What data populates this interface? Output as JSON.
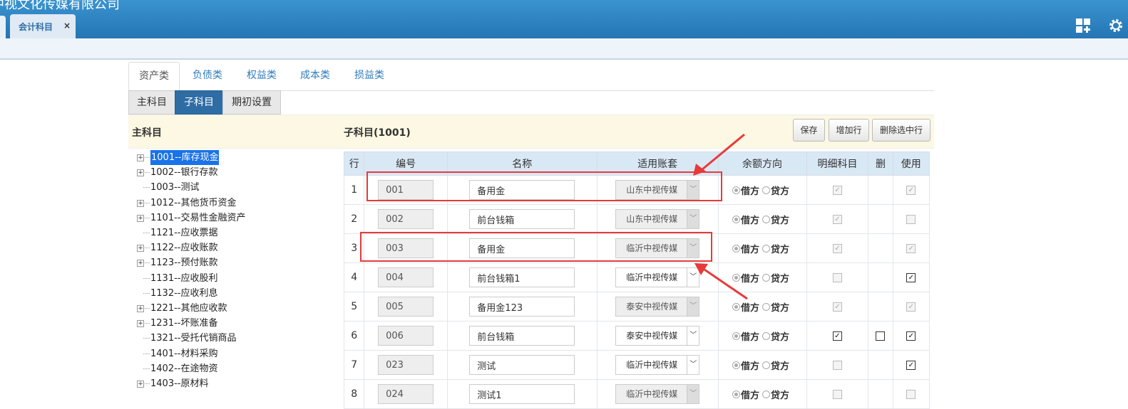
{
  "header": {
    "company": "中视文化传媒有限公司",
    "tab_label": "会计科目",
    "tab_close": "×"
  },
  "nav_tabs": [
    "资产类",
    "负债类",
    "权益类",
    "成本类",
    "损益类"
  ],
  "sub_tabs": [
    "主科目",
    "子科目",
    "期初设置"
  ],
  "panel": {
    "left_title": "主科目",
    "mid_title": "子科目(1001)",
    "buttons": [
      "保存",
      "增加行",
      "删除选中行"
    ]
  },
  "tree": [
    {
      "label": "1001--库存现金",
      "expandable": true,
      "selected": true
    },
    {
      "label": "1002--银行存款",
      "expandable": true
    },
    {
      "label": "1003--测试",
      "expandable": false
    },
    {
      "label": "1012--其他货币资金",
      "expandable": true
    },
    {
      "label": "1101--交易性金融资产",
      "expandable": true
    },
    {
      "label": "1121--应收票据",
      "expandable": false
    },
    {
      "label": "1122--应收账款",
      "expandable": true
    },
    {
      "label": "1123--预付账款",
      "expandable": true
    },
    {
      "label": "1131--应收股利",
      "expandable": false
    },
    {
      "label": "1132--应收利息",
      "expandable": false
    },
    {
      "label": "1221--其他应收款",
      "expandable": true
    },
    {
      "label": "1231--坏账准备",
      "expandable": true
    },
    {
      "label": "1321--受托代销商品",
      "expandable": false
    },
    {
      "label": "1401--材料采购",
      "expandable": false
    },
    {
      "label": "1402--在途物资",
      "expandable": false
    },
    {
      "label": "1403--原材料",
      "expandable": true
    }
  ],
  "table": {
    "headers": [
      "行",
      "编号",
      "名称",
      "适用账套",
      "余额方向",
      "明细科目",
      "删",
      "使用"
    ],
    "direction_labels": [
      "借方",
      "贷方"
    ],
    "rows": [
      {
        "row": "1",
        "code": "001",
        "name": "备用金",
        "book": "山东中视传媒",
        "book_enabled": false,
        "debit": true,
        "detail": true,
        "detail_enabled": false,
        "del_box": false,
        "use": true,
        "use_enabled": false
      },
      {
        "row": "2",
        "code": "002",
        "name": "前台钱箱",
        "book": "山东中视传媒",
        "book_enabled": false,
        "debit": true,
        "detail": true,
        "detail_enabled": false,
        "del_box": false,
        "use": false,
        "use_enabled": false
      },
      {
        "row": "3",
        "code": "003",
        "name": "备用金",
        "book": "临沂中视传媒",
        "book_enabled": false,
        "debit": true,
        "detail": true,
        "detail_enabled": false,
        "del_box": false,
        "use": true,
        "use_enabled": false
      },
      {
        "row": "4",
        "code": "004",
        "name": "前台钱箱1",
        "book": "临沂中视传媒",
        "book_enabled": true,
        "debit": true,
        "detail": false,
        "detail_enabled": false,
        "del_box": false,
        "use": true,
        "use_enabled": true
      },
      {
        "row": "5",
        "code": "005",
        "name": "备用金123",
        "book": "泰安中视传媒",
        "book_enabled": false,
        "debit": true,
        "detail": true,
        "detail_enabled": false,
        "del_box": false,
        "use": true,
        "use_enabled": false
      },
      {
        "row": "6",
        "code": "006",
        "name": "前台钱箱",
        "book": "泰安中视传媒",
        "book_enabled": true,
        "debit": true,
        "detail": true,
        "detail_enabled": true,
        "del_box": true,
        "use": true,
        "use_enabled": true
      },
      {
        "row": "7",
        "code": "023",
        "name": "测试",
        "book": "临沂中视传媒",
        "book_enabled": true,
        "debit": true,
        "detail": false,
        "detail_enabled": false,
        "del_box": false,
        "use": true,
        "use_enabled": true
      },
      {
        "row": "8",
        "code": "024",
        "name": "测试1",
        "book": "临沂中视传媒",
        "book_enabled": false,
        "debit": true,
        "detail": false,
        "detail_enabled": false,
        "del_box": false,
        "use": false,
        "use_enabled": false
      }
    ]
  },
  "colors": {
    "accent": "#2e6da4",
    "header_bar": "#2476b4",
    "annotation": "#e83a3a"
  }
}
